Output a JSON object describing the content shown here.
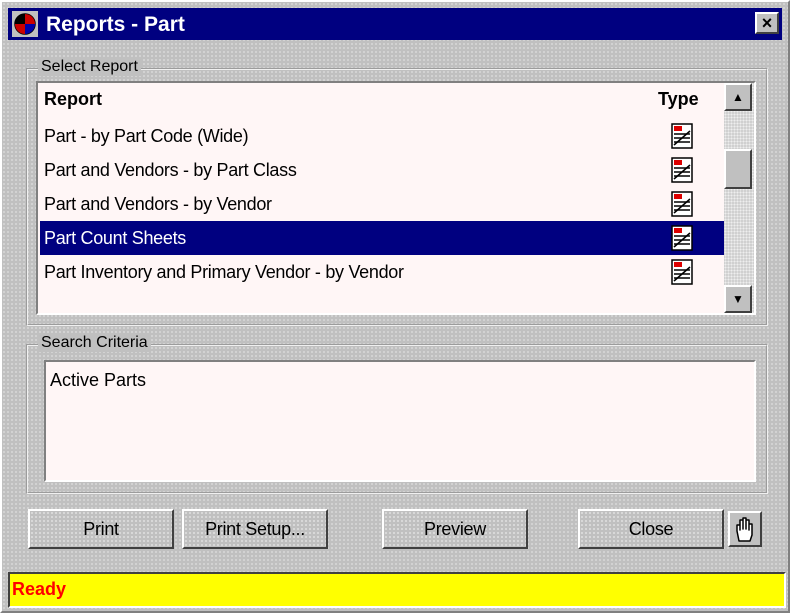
{
  "window": {
    "title": "Reports - Part",
    "close_glyph": "×",
    "app_icon": "app-logo-icon"
  },
  "select_report": {
    "legend": "Select Report",
    "columns": {
      "report": "Report",
      "type": "Type"
    },
    "rows": [
      {
        "label": "Part - by Part Code (Wide)",
        "icon": "report-type-icon",
        "selected": false
      },
      {
        "label": "Part and Vendors - by Part Class",
        "icon": "report-type-icon",
        "selected": false
      },
      {
        "label": "Part and Vendors - by Vendor",
        "icon": "report-type-icon",
        "selected": false
      },
      {
        "label": "Part Count Sheets",
        "icon": "report-type-icon",
        "selected": true
      },
      {
        "label": "Part Inventory and Primary Vendor - by Vendor",
        "icon": "report-type-icon",
        "selected": false
      }
    ],
    "scroll_up_glyph": "▲",
    "scroll_down_glyph": "▼"
  },
  "search_criteria": {
    "legend": "Search Criteria",
    "value": "Active Parts"
  },
  "buttons": {
    "print": "Print",
    "print_setup": "Print Setup...",
    "preview": "Preview",
    "close": "Close",
    "hand_icon": "hand-icon"
  },
  "status": {
    "text": "Ready",
    "color": "#ff0000",
    "background": "#ffff00"
  },
  "colors": {
    "title_bar": "#000080",
    "selection": "#000080",
    "list_background": "#fff6f6",
    "face": "#c0c0c0"
  }
}
